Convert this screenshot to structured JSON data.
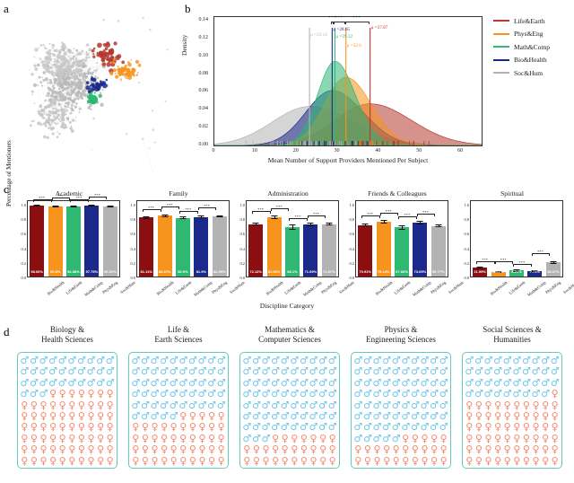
{
  "panels": {
    "a": {
      "letter": "a"
    },
    "b": {
      "letter": "b"
    },
    "c": {
      "letter": "c"
    },
    "d": {
      "letter": "d"
    }
  },
  "colors": {
    "life_earth": "#b5392f",
    "phys_eng": "#f7941e",
    "math_comp": "#2eb872",
    "bio_health": "#1b2a8a",
    "soc_hum": "#b3b3b3",
    "dark_red": "#8b0f10",
    "male": "#6ec6e8",
    "female": "#f4866b",
    "box_border": "#5fcdb7"
  },
  "chart_data": [
    {
      "type": "line",
      "panel": "b",
      "title": "",
      "xlabel": "Mean Number of Support Providers Mentioned Per Subject",
      "ylabel": "Density",
      "xlim": [
        0,
        65
      ],
      "ylim": [
        0,
        0.145
      ],
      "xticks": [
        "0",
        "10",
        "20",
        "30",
        "40",
        "50",
        "60"
      ],
      "yticks": [
        "0.00",
        "0.02",
        "0.04",
        "0.06",
        "0.08",
        "0.10",
        "0.12",
        "0.14"
      ],
      "grid": false,
      "legend_position": "right",
      "legend": [
        "Life&Earth",
        "Phys&Eng",
        "Math&Comp",
        "Bio&Health",
        "Soc&Hum"
      ],
      "series": [
        {
          "name": "Life&Earth",
          "mean": 37.87,
          "mean_label": "μ =37.87",
          "color": "#b5392f",
          "sd": 8.5,
          "peak": 0.047
        },
        {
          "name": "Phys&Eng",
          "mean": 32.0,
          "mean_label": "μ =32.0",
          "color": "#f7941e",
          "sd": 5.2,
          "peak": 0.077
        },
        {
          "name": "Math&Comp",
          "mean": 29.32,
          "mean_label": "μ =29.32",
          "color": "#2eb872",
          "sd": 4.2,
          "peak": 0.095
        },
        {
          "name": "Bio&Health",
          "mean": 28.65,
          "mean_label": "μ =28.65",
          "color": "#1b2a8a",
          "sd": 6.4,
          "peak": 0.062
        },
        {
          "name": "Soc&Hum",
          "mean": 23.14,
          "mean_label": "μ =23.14",
          "color": "#b3b3b3",
          "sd": 9.0,
          "peak": 0.044
        }
      ],
      "significance": [
        {
          "label": "***",
          "from": 28.65,
          "to": 29.32
        },
        {
          "label": "***",
          "from": 29.32,
          "to": 32.0
        },
        {
          "label": "***",
          "from": 32.0,
          "to": 37.87
        }
      ]
    },
    {
      "type": "bar",
      "panel": "c",
      "ylabel": "Percentage of Mentioners",
      "xlabel": "Discipline Category",
      "ylim": [
        0,
        1.05
      ],
      "yticks": [
        "0.0",
        "0.2",
        "0.4",
        "0.6",
        "0.8",
        "1.0"
      ],
      "categories": [
        "Bio&Health",
        "Life&Earth",
        "Math&Comp",
        "Phys&Eng",
        "Soc&Hum"
      ],
      "bar_colors": [
        "#8b0f10",
        "#f7941e",
        "#2eb872",
        "#1b2a8a",
        "#b3b3b3"
      ],
      "groups": [
        {
          "title": "Academic",
          "values": [
            0.9806,
            0.968,
            0.9658,
            0.9775,
            0.9652
          ],
          "labels": [
            "98.06%",
            "96.8%",
            "96.58%",
            "97.75%",
            "96.52%"
          ],
          "errors": [
            0.008,
            0.01,
            0.011,
            0.009,
            0.009
          ],
          "significance": [
            "***",
            "***",
            "***",
            "***"
          ]
        },
        {
          "title": "Family",
          "values": [
            0.8111,
            0.8347,
            0.809,
            0.819,
            0.8299
          ],
          "labels": [
            "81.11%",
            "83.47%",
            "80.9%",
            "81.9%",
            "82.99%"
          ],
          "errors": [
            0.016,
            0.022,
            0.02,
            0.018,
            0.014
          ],
          "significance": [
            "***",
            "***",
            "***",
            "***"
          ]
        },
        {
          "title": "Administration",
          "values": [
            0.7212,
            0.8166,
            0.681,
            0.7169,
            0.7187
          ],
          "labels": [
            "72.12%",
            "81.66%",
            "68.1%",
            "71.69%",
            "71.87%"
          ],
          "errors": [
            0.02,
            0.024,
            0.035,
            0.024,
            0.018
          ],
          "significance": [
            "***",
            "***",
            "***",
            "***"
          ]
        },
        {
          "title": "Friends & Colleagues",
          "values": [
            0.7091,
            0.7514,
            0.6766,
            0.7369,
            0.6977
          ],
          "labels": [
            "70.91%",
            "75.14%",
            "67.66%",
            "73.69%",
            "69.77%"
          ],
          "errors": [
            0.022,
            0.026,
            0.03,
            0.024,
            0.02
          ],
          "significance": [
            "***",
            "***",
            "***",
            "***"
          ]
        },
        {
          "title": "Spiritual",
          "values": [
            0.1199,
            0.0661,
            0.0821,
            0.0771,
            0.1967
          ],
          "labels": [
            "11.99%",
            "6.61%",
            "8.21%",
            "7.71%",
            "19.67%"
          ],
          "errors": [
            0.016,
            0.012,
            0.016,
            0.013,
            0.018
          ],
          "significance": [
            "***",
            "***",
            "***",
            "***"
          ]
        }
      ]
    },
    {
      "type": "table",
      "panel": "d",
      "note": "100-square waffle pictograms of gender composition per discipline",
      "male_symbol": "♂",
      "female_symbol": "♀",
      "groups": [
        {
          "title_line1": "Biology &",
          "title_line2": "Health Sciences",
          "male": 33,
          "female": 67
        },
        {
          "title_line1": "Life &",
          "title_line2": "Earth Sciences",
          "male": 55,
          "female": 45
        },
        {
          "title_line1": "Mathematics &",
          "title_line2": "Computer Sciences",
          "male": 73,
          "female": 27
        },
        {
          "title_line1": "Physics &",
          "title_line2": "Engineering Sciences",
          "male": 75,
          "female": 25
        },
        {
          "title_line1": "Social Sciences &",
          "title_line2": "Humanities",
          "male": 39,
          "female": 61
        }
      ]
    }
  ]
}
